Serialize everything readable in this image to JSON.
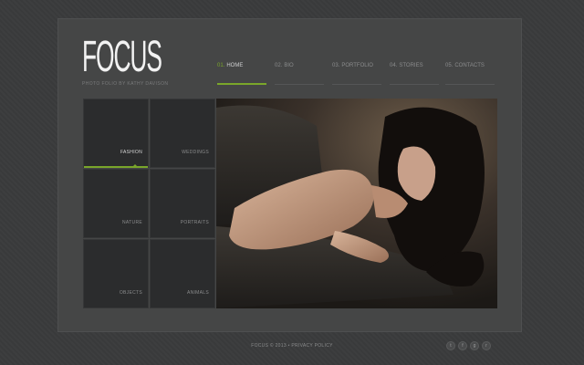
{
  "brand": {
    "logo": "FOCUS",
    "tagline": "PHOTO FOLIO BY KATHY DAVISON"
  },
  "nav": {
    "items": [
      {
        "num": "01.",
        "label": "HOME",
        "active": true
      },
      {
        "num": "02.",
        "label": "BIO",
        "active": false
      },
      {
        "num": "03.",
        "label": "PORTFOLIO",
        "active": false
      },
      {
        "num": "04.",
        "label": "STORIES",
        "active": false
      },
      {
        "num": "05.",
        "label": "CONTACTS",
        "active": false
      }
    ]
  },
  "gallery": {
    "categories": [
      {
        "label": "FASHION",
        "active": true
      },
      {
        "label": "WEDDINGS",
        "active": false
      },
      {
        "label": "NATURE",
        "active": false
      },
      {
        "label": "PORTRAITS",
        "active": false
      },
      {
        "label": "OBJECTS",
        "active": false
      },
      {
        "label": "ANIMALS",
        "active": false
      }
    ]
  },
  "footer": {
    "text": "FOCUS © 2013 • PRIVACY POLICY"
  },
  "social": {
    "icons": [
      "twitter-icon",
      "facebook-icon",
      "google-plus-icon",
      "rss-icon"
    ],
    "glyphs": [
      "t",
      "f",
      "g",
      "r"
    ]
  },
  "colors": {
    "accent": "#7aa62a",
    "background": "#3a3b3c",
    "panel": "#454646",
    "tile": "#2b2c2d"
  }
}
